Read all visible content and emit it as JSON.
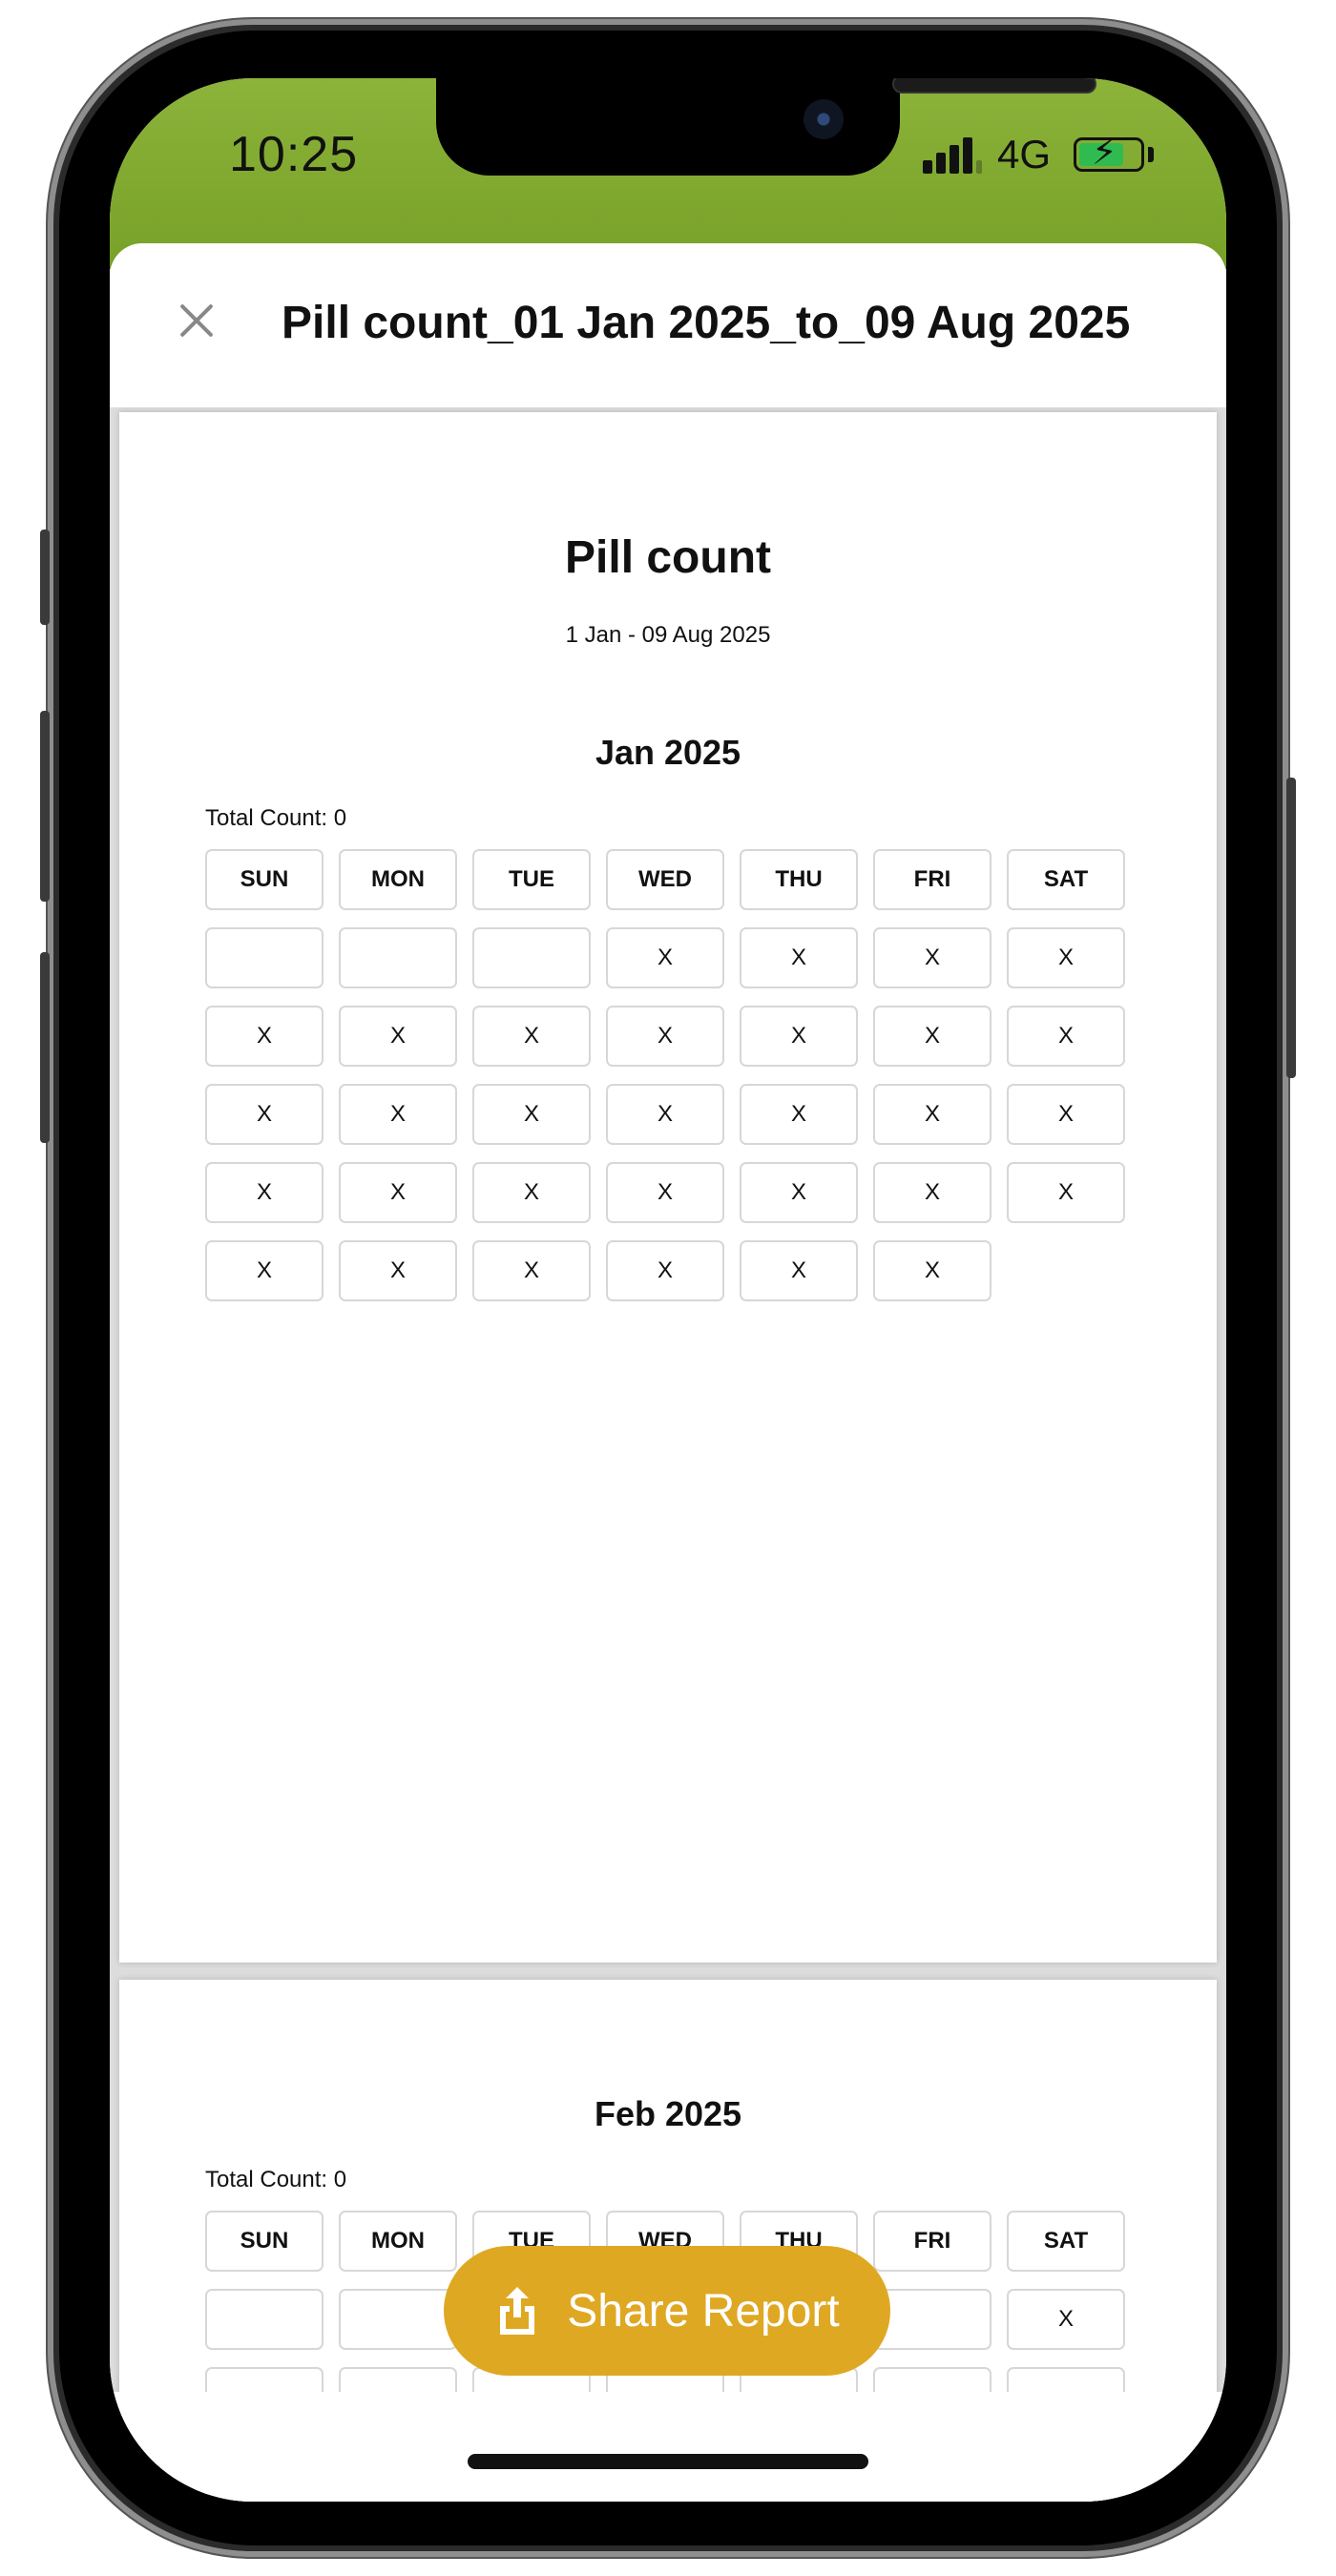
{
  "status_bar": {
    "time": "10:25",
    "network": "4G",
    "battery_color": "#2fbb4f"
  },
  "header": {
    "title": "Pill count_01 Jan 2025_to_09 Aug 2025",
    "close_icon": "close-icon"
  },
  "document": {
    "title": "Pill count",
    "date_range": "1 Jan - 09 Aug 2025",
    "weekdays": [
      "SUN",
      "MON",
      "TUE",
      "WED",
      "THU",
      "FRI",
      "SAT"
    ],
    "months": [
      {
        "title": "Jan 2025",
        "total_label": "Total Count: 0",
        "weeks": [
          [
            "",
            "",
            "",
            "X",
            "X",
            "X",
            "X"
          ],
          [
            "X",
            "X",
            "X",
            "X",
            "X",
            "X",
            "X"
          ],
          [
            "X",
            "X",
            "X",
            "X",
            "X",
            "X",
            "X"
          ],
          [
            "X",
            "X",
            "X",
            "X",
            "X",
            "X",
            "X"
          ],
          [
            "X",
            "X",
            "X",
            "X",
            "X",
            "X",
            null
          ]
        ]
      },
      {
        "title": "Feb 2025",
        "total_label": "Total Count: 0",
        "weeks": [
          [
            "",
            "",
            "",
            "",
            "",
            "",
            "X"
          ],
          [
            "",
            "",
            "",
            "",
            "",
            "",
            ""
          ]
        ]
      }
    ]
  },
  "share_button": {
    "label": "Share Report",
    "color": "#dfa823",
    "icon": "share-icon"
  },
  "brand_color": "#8cb33a"
}
